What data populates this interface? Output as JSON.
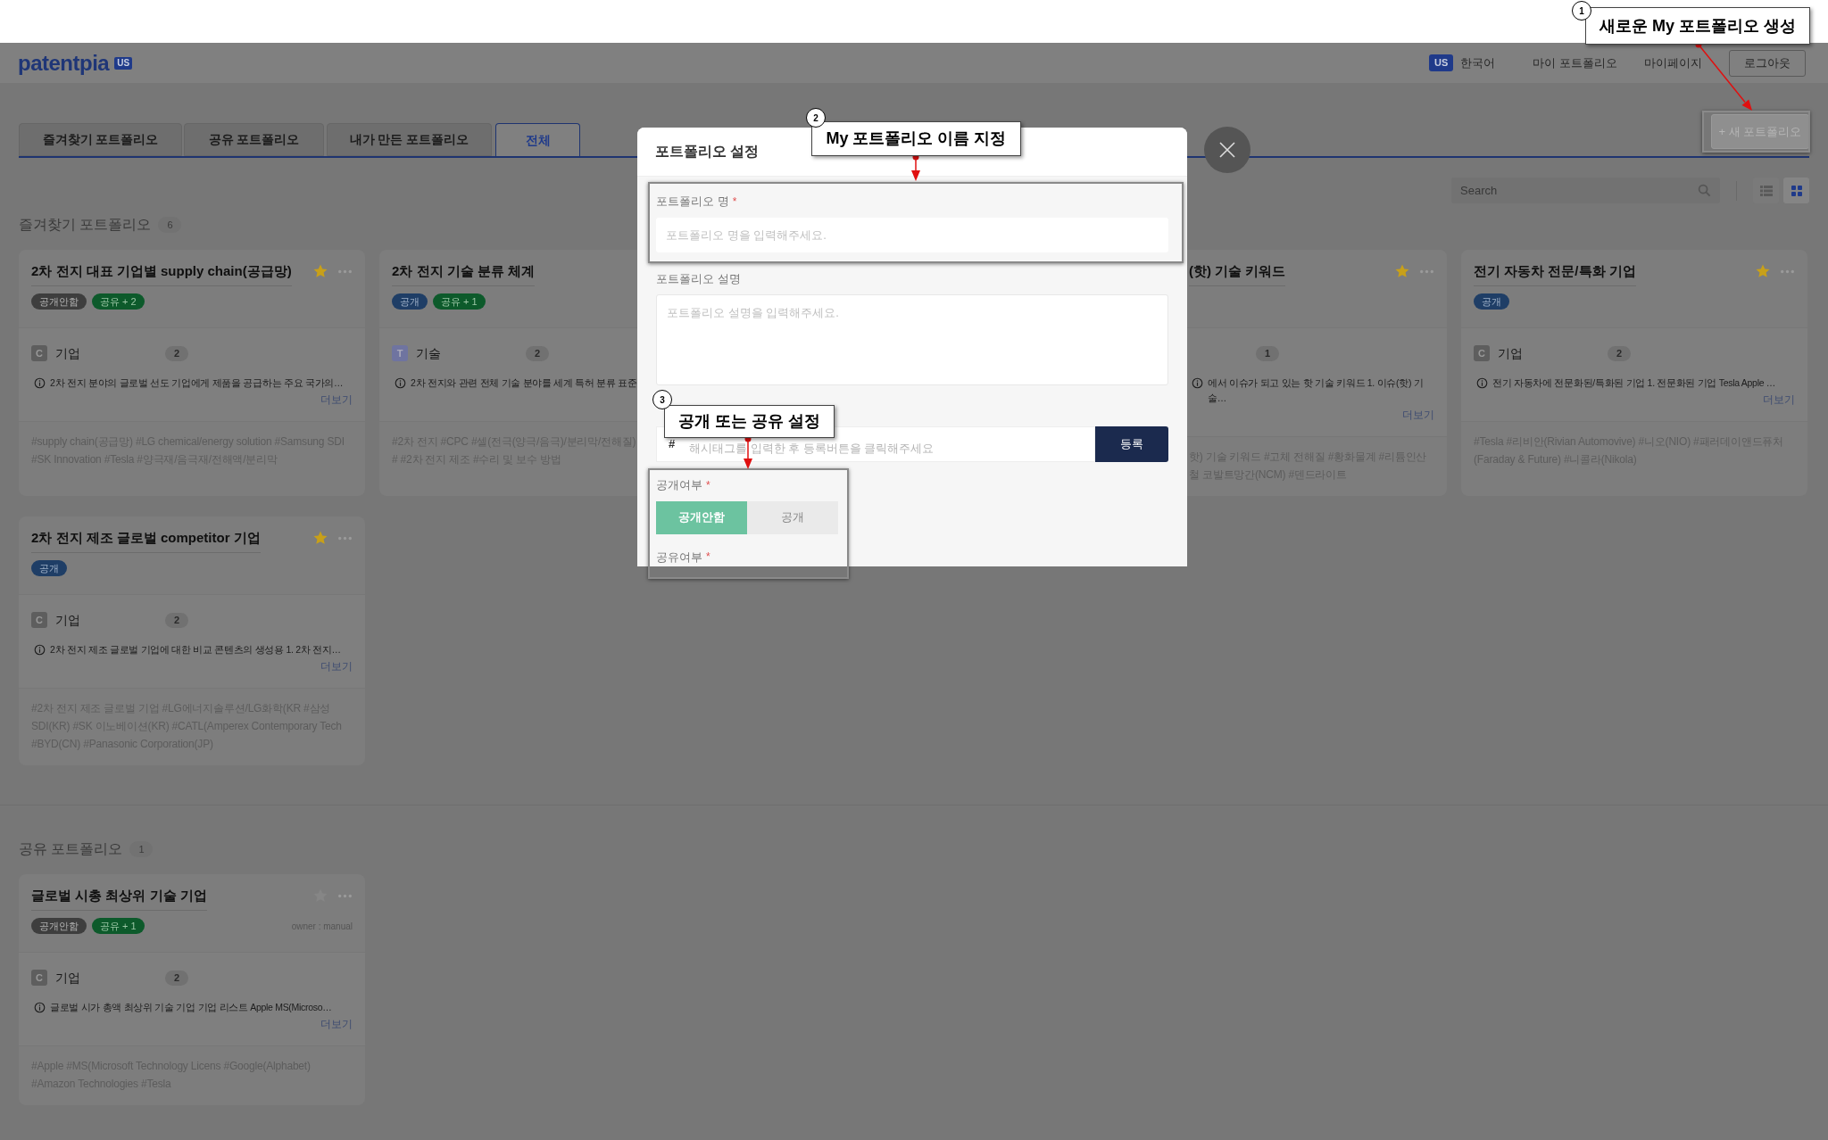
{
  "header": {
    "logo": "patentpia",
    "logo_badge": "US",
    "lang_badge": "US",
    "language": "한국어",
    "nav": [
      "마이 포트폴리오",
      "마이페이지"
    ],
    "logout": "로그아웃"
  },
  "tabs": [
    {
      "label": "즐겨찾기 포트폴리오",
      "selected": false
    },
    {
      "label": "공유 포트폴리오",
      "selected": false
    },
    {
      "label": "내가 만든 포트폴리오",
      "selected": false
    },
    {
      "label": "전체",
      "selected": true
    }
  ],
  "new_button": "+ 새 포트폴리오",
  "search": {
    "placeholder": "Search"
  },
  "view_toggles": [
    {
      "kind": "list",
      "selected": false
    },
    {
      "kind": "grid",
      "selected": true
    }
  ],
  "sections": [
    {
      "title": "즐겨찾기 포트폴리오",
      "count": "6",
      "cards": [
        {
          "kind": "full",
          "title": "2차 전지 대표 기업별 supply chain(공급망)",
          "starred": true,
          "badges": [
            {
              "kind": "private",
              "label": "공개안함"
            },
            {
              "kind": "shared",
              "label": "공유 + 2"
            }
          ],
          "category": {
            "kind": "company",
            "letter": "C",
            "label": "기업",
            "count": "2"
          },
          "description": "2차 전지 분야의 글로벌 선도 기업에게 제품을 공급하는 주요 국가의…",
          "more": "더보기",
          "tags": "#supply chain(공급망) #LG chemical/energy solution #Samsung SDI #SK Innovation #Tesla #양극재/음극재/전해액/분리막"
        },
        {
          "kind": "cut_right",
          "title": "2차 전지 기술 분류 체계",
          "badges": [
            {
              "kind": "public",
              "label": "공개"
            },
            {
              "kind": "shared",
              "label": "공유 + 1"
            }
          ],
          "category": {
            "kind": "technology",
            "letter": "T",
            "label": "기술",
            "count": "2"
          },
          "description": "2차 전지와 관련 전체 기술 분야를 세계 특허 분류 표준",
          "tags": "#2차 전지 #CPC #셀(전극(양극/음극)/분리막/전해질) # #2차 전지 제조 #수리 및 보수 방법"
        },
        {
          "kind": "cut_left",
          "title": "(핫) 기술 키워드",
          "starred": true,
          "category": {
            "count": "1"
          },
          "description": "에서 이슈가 되고 있는 핫 기술 키워드 1. 이슈(핫) 기술…",
          "more": "더보기",
          "tags": "핫) 기술 키워드 #고체 전해질 #황화물계 #리튬인산철 코발트망간(NCM) #덴드라이트"
        },
        {
          "kind": "full",
          "title": "전기 자동차 전문/특화 기업",
          "starred": true,
          "badges": [
            {
              "kind": "public",
              "label": "공개"
            }
          ],
          "category": {
            "kind": "company",
            "letter": "C",
            "label": "기업",
            "count": "2"
          },
          "description": "전기 자동차에 전문화된/특화된 기업 1. 전문화된 기업 Tesla Apple …",
          "more": "더보기",
          "tags": "#Tesla #리비안(Rivian Automovive) #니오(NIO) #패러데이앤드퓨처 (Faraday & Future) #니콜라(Nikola)"
        },
        {
          "kind": "full",
          "title": "2차 전지 제조 글로벌 competitor 기업",
          "starred": true,
          "badges": [
            {
              "kind": "public",
              "label": "공개"
            }
          ],
          "category": {
            "kind": "company",
            "letter": "C",
            "label": "기업",
            "count": "2"
          },
          "description": "2차 전지 제조 글로벌 기업에 대한 비교 콘텐츠의 생성용 1. 2차 전지…",
          "more": "더보기",
          "tags": "#2차 전지 제조 글로벌 기업 #LG에너지솔루션/LG화학(KR #삼성SDI(KR) #SK 이노베이션(KR) #CATL(Amperex Contemporary Tech #BYD(CN) #Panasonic Corporation(JP)"
        }
      ]
    },
    {
      "title": "공유 포트폴리오",
      "count": "1",
      "cards": [
        {
          "kind": "full",
          "title": "글로벌 시총 최상위 기술 기업",
          "starred": false,
          "badges": [
            {
              "kind": "private",
              "label": "공개안함"
            },
            {
              "kind": "shared",
              "label": "공유 + 1"
            }
          ],
          "owner": "owner : manual",
          "category": {
            "kind": "company",
            "letter": "C",
            "label": "기업",
            "count": "2"
          },
          "description": "글로벌 시가 총액 최상위 기술 기업 기업 리스트 Apple MS(Microso…",
          "more": "더보기",
          "tags": "#Apple #MS(Microsoft Technology Licens #Google(Alphabet) #Amazon Technologies #Tesla"
        }
      ]
    }
  ],
  "dialog": {
    "title": "포트폴리오 설정",
    "name_label": "포트폴리오 명",
    "name_placeholder": "포트폴리오 명을 입력해주세요.",
    "description_label": "포트폴리오 설명",
    "description_placeholder": "포트폴리오 설명을 입력해주세요.",
    "hashtag_prefix": "#",
    "hashtag_placeholder": "해시태그를 입력한 후 등록버튼을 클릭해주세요",
    "register_button": "등록",
    "visibility_label": "공개여부",
    "visibility_options": [
      {
        "label": "공개안함",
        "selected": true
      },
      {
        "label": "공개",
        "selected": false
      }
    ],
    "sharing_label": "공유여부",
    "required_mark": "*"
  },
  "annotations": [
    {
      "number": "1",
      "text": "새로운 My 포트폴리오 생성"
    },
    {
      "number": "2",
      "text": "My 포트폴리오 이름 지정"
    },
    {
      "number": "3",
      "text": "공개 또는 공유 설정"
    }
  ]
}
